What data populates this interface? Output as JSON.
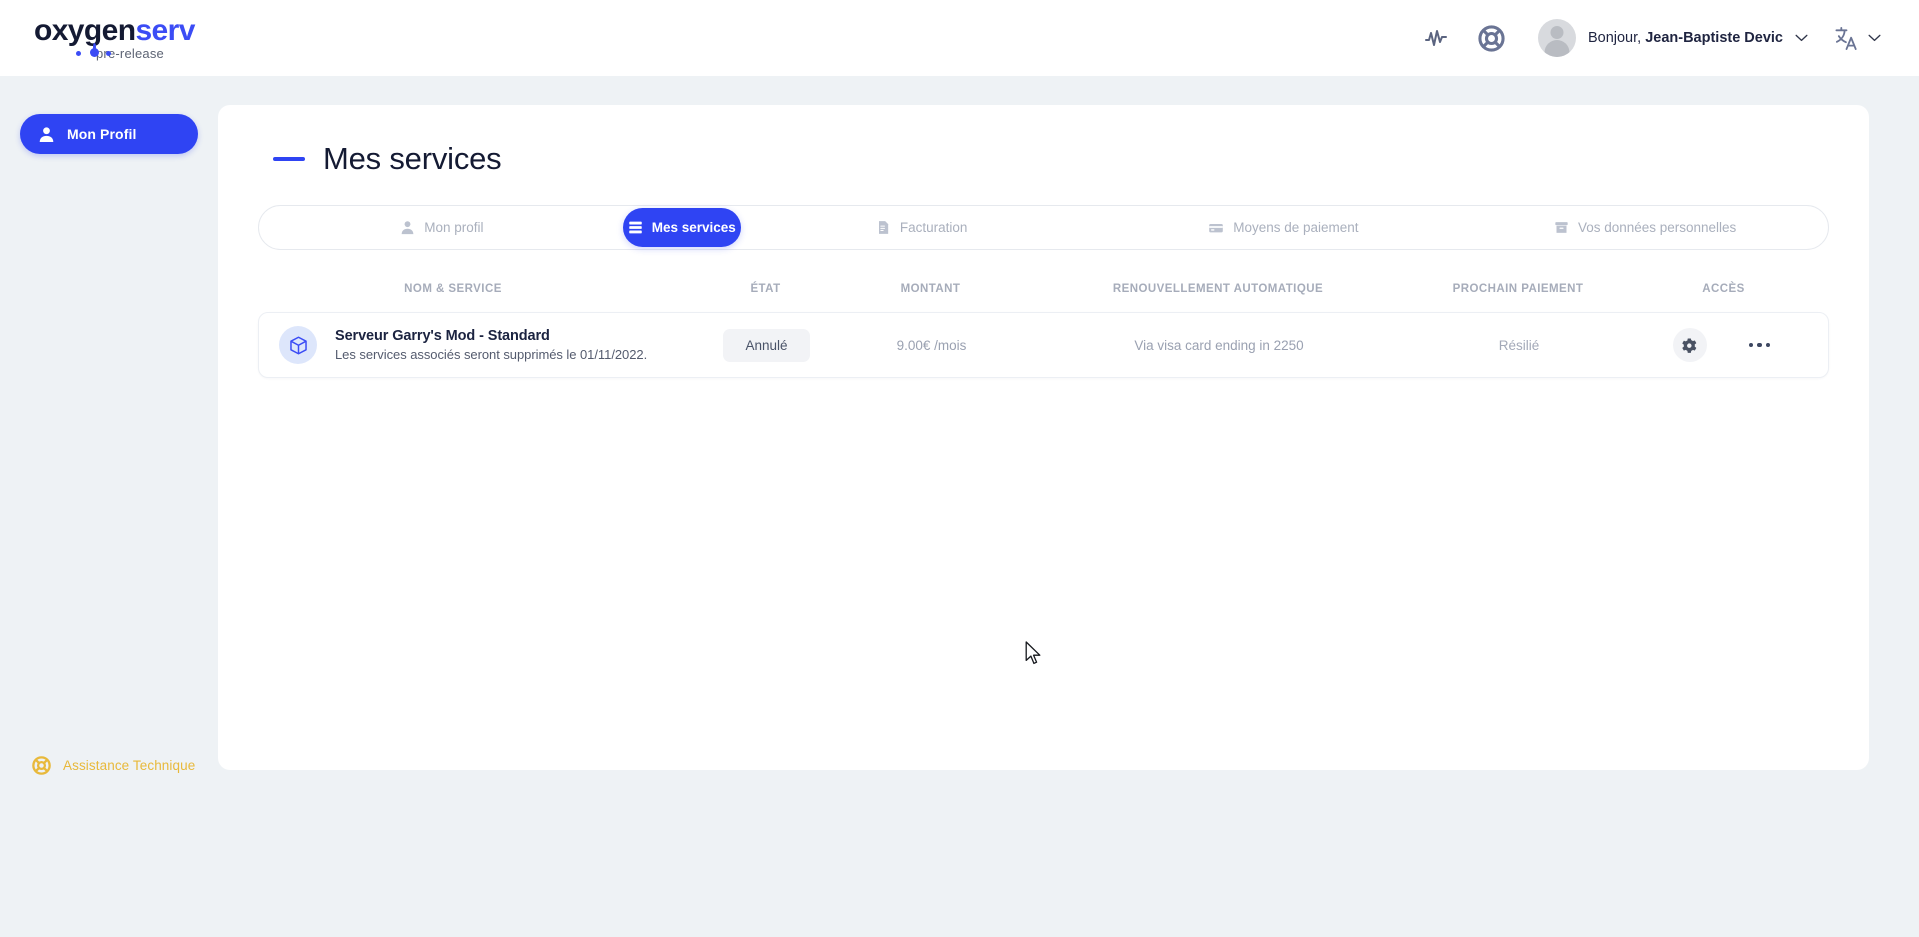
{
  "brand": {
    "word_dark": "oxy",
    "word_mid": "gen",
    "word_blue": "serv",
    "tagline": "pre-release"
  },
  "header": {
    "activity_icon": "activity-pulse-icon",
    "support_icon": "lifebuoy-icon",
    "avatar_icon": "user-avatar",
    "greeting": "Bonjour,",
    "user_name": "Jean-Baptiste Devic",
    "account_chevron": "chevron-down-icon",
    "language_icon": "translate-icon",
    "language_chevron": "chevron-down-icon"
  },
  "sidebar": {
    "nav": {
      "icon": "person-icon",
      "label": "Mon Profil"
    },
    "support": {
      "icon": "lifebuoy-icon",
      "label": "Assistance Technique",
      "color": "#e8b93b"
    }
  },
  "main": {
    "title": "Mes services",
    "accent_color": "#2f44f3",
    "tabs": [
      {
        "label": "Mon profil",
        "icon": "person-icon",
        "active": false
      },
      {
        "label": "Mes services",
        "icon": "server-stack-icon",
        "active": true
      },
      {
        "label": "Facturation",
        "icon": "invoice-document-icon",
        "active": false
      },
      {
        "label": "Moyens de paiement",
        "icon": "credit-card-icon",
        "active": false
      },
      {
        "label": "Vos données personnelles",
        "icon": "archive-box-icon",
        "active": false
      }
    ],
    "table": {
      "columns": [
        "NOM & SERVICE",
        "ÉTAT",
        "MONTANT",
        "RENOUVELLEMENT AUTOMATIQUE",
        "PROCHAIN PAIEMENT",
        "ACCÈS"
      ],
      "rows": [
        {
          "icon": "cube-box-icon",
          "name": "Serveur Garry's Mod - Standard",
          "note": "Les services associés seront supprimés le 01/11/2022.",
          "state": "Annulé",
          "amount": "9.00€ /mois",
          "renewal": "Via visa card ending in 2250",
          "next_payment": "Résilié",
          "gear_icon": "gear-icon",
          "more_icon": "ellipsis-horizontal-icon"
        }
      ]
    }
  }
}
